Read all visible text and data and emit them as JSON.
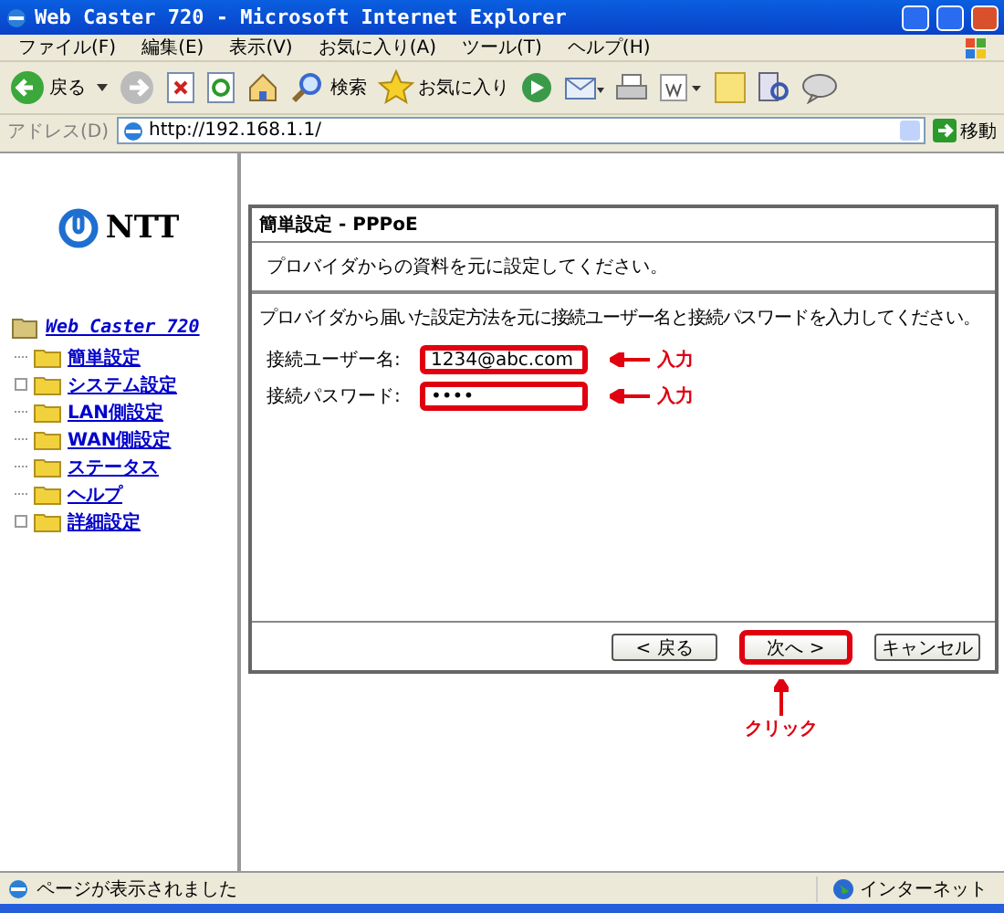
{
  "window": {
    "title": "Web Caster 720 - Microsoft Internet Explorer"
  },
  "menu": [
    "ファイル(F)",
    "編集(E)",
    "表示(V)",
    "お気に入り(A)",
    "ツール(T)",
    "ヘルプ(H)"
  ],
  "toolbar": [
    {
      "label": "戻る"
    },
    {
      "label": "検索"
    },
    {
      "label": "お気に入り"
    }
  ],
  "address": {
    "label": "アドレス(D)",
    "url": "http://192.168.1.1/",
    "go": "移動"
  },
  "sidebar": {
    "logo": "NTT",
    "root": "Web Caster 720",
    "items": [
      {
        "label": "簡単設定",
        "expandable": false
      },
      {
        "label": "システム設定",
        "expandable": true
      },
      {
        "label": "LAN側設定",
        "expandable": false
      },
      {
        "label": "WAN側設定",
        "expandable": false
      },
      {
        "label": "ステータス",
        "expandable": false
      },
      {
        "label": "ヘルプ",
        "expandable": false
      },
      {
        "label": "詳細設定",
        "expandable": true
      }
    ]
  },
  "panel": {
    "title": "簡単設定 - PPPoE",
    "subtitle": "プロバイダからの資料を元に設定してください。",
    "instruction": "プロバイダから届いた設定方法を元に接続ユーザー名と接続パスワードを入力してください。",
    "fields": [
      {
        "label": "接続ユーザー名:",
        "value": "1234@abc.com",
        "highlighted": true,
        "note": "入力"
      },
      {
        "label": "接続パスワード:",
        "value": "••••",
        "highlighted": true,
        "note": "入力"
      }
    ],
    "buttons": [
      {
        "label": "< 戻る",
        "highlighted": false
      },
      {
        "label": "次へ >",
        "highlighted": true
      },
      {
        "label": "キャンセル",
        "highlighted": false
      }
    ],
    "click_note": "クリック"
  },
  "status_bar": {
    "message": "ページが表示されました",
    "zone": "インターネット"
  }
}
